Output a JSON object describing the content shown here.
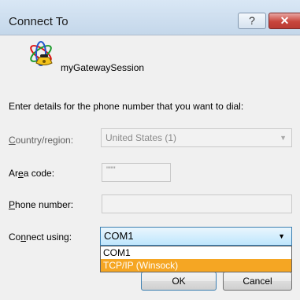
{
  "window": {
    "title": "Connect To",
    "help_label": "?",
    "close_label": "✕"
  },
  "session": {
    "name": "myGatewaySession",
    "icon": "phone-globe-icon"
  },
  "prompt": "Enter details for the phone number that you want to dial:",
  "fields": {
    "country_label_accel": "C",
    "country_label_rest": "ountry/region:",
    "country_value": "United States (1)",
    "area_label_pre": "Ar",
    "area_label_accel": "e",
    "area_label_post": "a code:",
    "area_value": "\"\"\"",
    "phone_label_accel": "P",
    "phone_label_rest": "hone number:",
    "phone_value": "",
    "connect_label_pre": "Co",
    "connect_label_accel": "n",
    "connect_label_post": "nect using:",
    "connect_value": "COM1"
  },
  "dropdown": {
    "options": [
      "COM1",
      "TCP/IP (Winsock)"
    ],
    "selected_index": 1
  },
  "buttons": {
    "ok": "OK",
    "cancel": "Cancel"
  },
  "colors": {
    "selection": "#f5a623",
    "close": "#c8453c"
  }
}
